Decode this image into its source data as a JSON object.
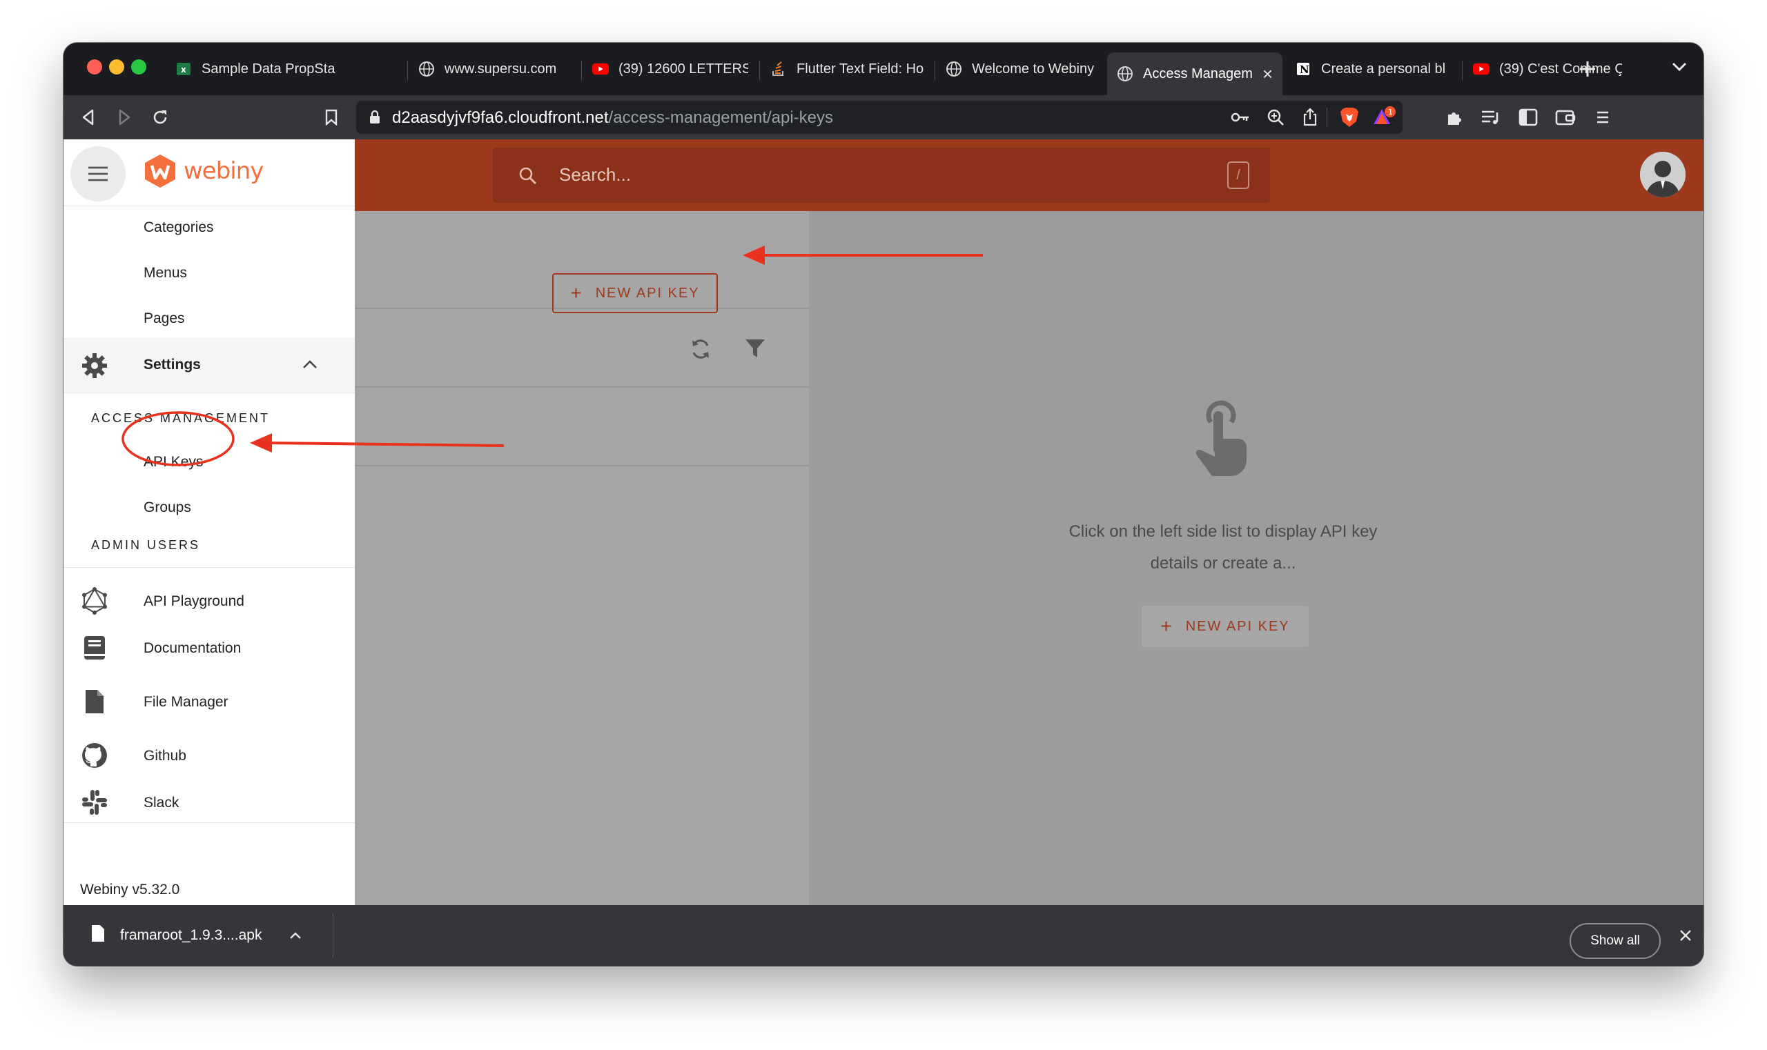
{
  "browser": {
    "tabs": [
      {
        "title": "Sample Data PropSta",
        "icon": "excel-icon"
      },
      {
        "title": "www.supersu.com",
        "icon": "globe-icon"
      },
      {
        "title": "(39) 12600 LETTERS",
        "icon": "youtube-icon"
      },
      {
        "title": "Flutter Text Field: Ho",
        "icon": "stackoverflow-icon"
      },
      {
        "title": "Welcome to Webiny",
        "icon": "globe-icon"
      },
      {
        "title": "Access Managem",
        "icon": "globe-icon",
        "active": true
      },
      {
        "title": "Create a personal bl",
        "icon": "notion-icon"
      },
      {
        "title": "(39) C'est Comme Ç",
        "icon": "youtube-icon"
      }
    ],
    "url_host": "d2aasdyjvf9fa6.cloudfront.net",
    "url_path": "/access-management/api-keys",
    "brave_badge": "1"
  },
  "header": {
    "search_placeholder": "Search...",
    "search_shortcut": "/"
  },
  "drawer": {
    "logo_text": "webiny",
    "items_top": [
      {
        "label": "Categories"
      },
      {
        "label": "Menus"
      },
      {
        "label": "Pages"
      }
    ],
    "settings_label": "Settings",
    "access_management_title": "ACCESS MANAGEMENT",
    "access_items": [
      {
        "label": "API Keys"
      },
      {
        "label": "Groups"
      }
    ],
    "admin_users_title": "ADMIN USERS",
    "links": [
      {
        "label": "API Playground",
        "icon": "graphql-icon"
      },
      {
        "label": "Documentation",
        "icon": "book-icon"
      },
      {
        "label": "File Manager",
        "icon": "file-icon"
      },
      {
        "label": "Github",
        "icon": "github-icon"
      },
      {
        "label": "Slack",
        "icon": "slack-icon"
      }
    ],
    "version": "Webiny v5.32.0"
  },
  "main": {
    "new_api_key_label": "NEW API KEY",
    "empty_state_text": "Click on the left side list to display API key details or create a...",
    "detail_new_api_key_label": "NEW API KEY"
  },
  "downloads": {
    "file_name": "framaroot_1.9.3....apk",
    "show_all_label": "Show all"
  },
  "colors": {
    "brand": "#f56f3d",
    "header_dim": "#9d3a1d",
    "annotation_red": "#e8321e"
  }
}
